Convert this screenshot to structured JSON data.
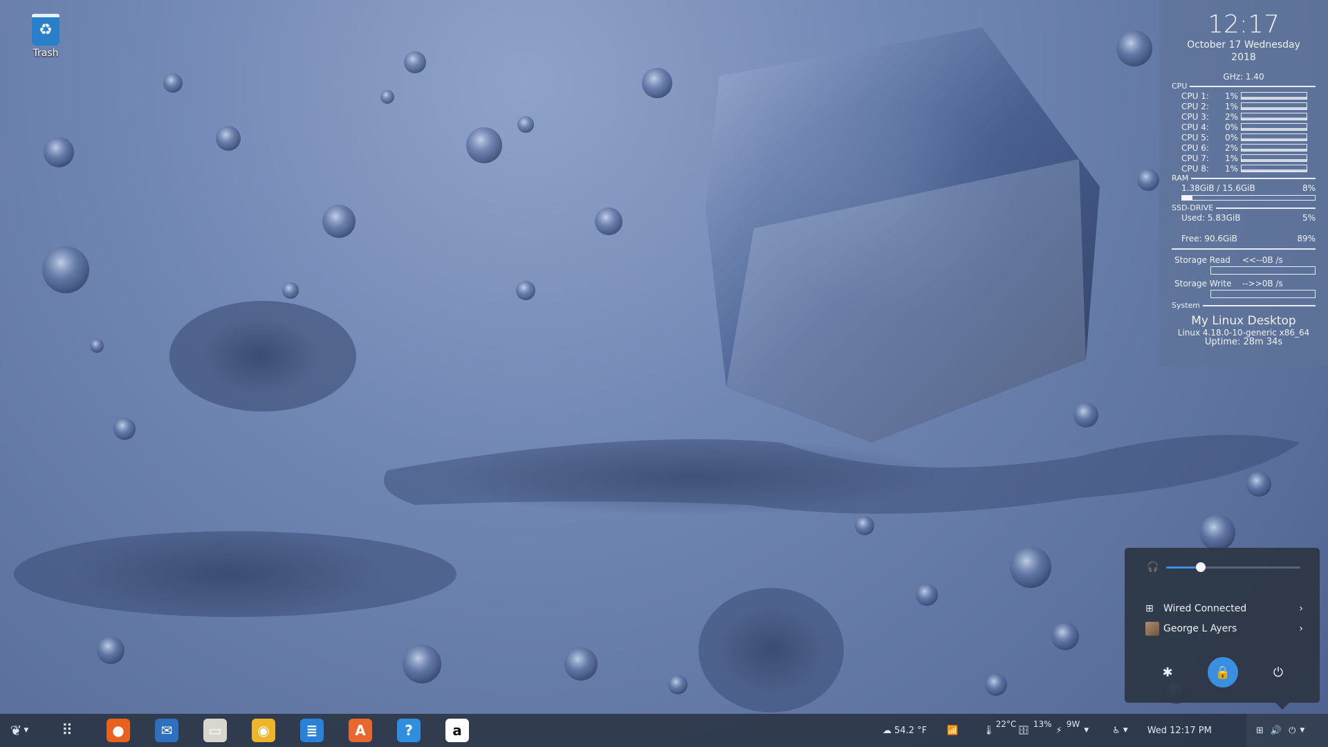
{
  "desktop": {
    "trash_label": "Trash"
  },
  "conky": {
    "time": "12:17",
    "date_line1": "October 17 Wednesday",
    "date_line2": "2018",
    "ghz": "GHz: 1.40",
    "cpu_title": "CPU",
    "cpus": [
      {
        "name": "CPU 1:",
        "percent": "1%"
      },
      {
        "name": "CPU 2:",
        "percent": "1%"
      },
      {
        "name": "CPU 3:",
        "percent": "2%"
      },
      {
        "name": "CPU 4:",
        "percent": "0%"
      },
      {
        "name": "CPU 5:",
        "percent": "0%"
      },
      {
        "name": "CPU 6:",
        "percent": "2%"
      },
      {
        "name": "CPU 7:",
        "percent": "1%"
      },
      {
        "name": "CPU 8:",
        "percent": "1%"
      }
    ],
    "ram_title": "RAM",
    "ram_usage": "1.38GiB / 15.6GiB",
    "ram_percent": "8%",
    "ram_fraction": 0.08,
    "ssd_title": "SSD-DRIVE",
    "ssd_used_label": "Used:  5.83GiB",
    "ssd_used_percent": "5%",
    "ssd_free_label": "Free:  90.6GiB",
    "ssd_free_percent": "89%",
    "storage_read_label": "Storage Read",
    "storage_read_value": "<<--0B  /s",
    "storage_write_label": "Storage Write",
    "storage_write_value": "-->>0B  /s",
    "system_title": "System",
    "hostname": "My Linux Desktop",
    "kernel": "Linux 4.18.0-10-generic x86_64",
    "uptime": "Uptime: 28m 34s"
  },
  "popover": {
    "volume_fraction": 0.26,
    "wired_label": "Wired Connected",
    "user_label": "George L Ayers",
    "accent": "#3b8fe0"
  },
  "taskbar": {
    "apps": [
      {
        "name": "firefox",
        "glyph": "●",
        "color": "#e8611d"
      },
      {
        "name": "thunderbird",
        "glyph": "✉",
        "color": "#2f6fc0"
      },
      {
        "name": "files",
        "glyph": "▭",
        "color": "#d9d6cf"
      },
      {
        "name": "rhythmbox",
        "glyph": "◉",
        "color": "#f0b42a"
      },
      {
        "name": "libreoffice-writer",
        "glyph": "≣",
        "color": "#2a82d8"
      },
      {
        "name": "software-center",
        "glyph": "A",
        "color": "#e9662c"
      },
      {
        "name": "help",
        "glyph": "?",
        "color": "#2f8fde"
      },
      {
        "name": "amazon",
        "glyph": "a",
        "color": "#ffffff"
      }
    ],
    "weather": "54.2 °F",
    "cpu_temp": "22°C",
    "disk_percent": "13%",
    "power": "9W",
    "datetime": "Wed 12:17 PM"
  }
}
